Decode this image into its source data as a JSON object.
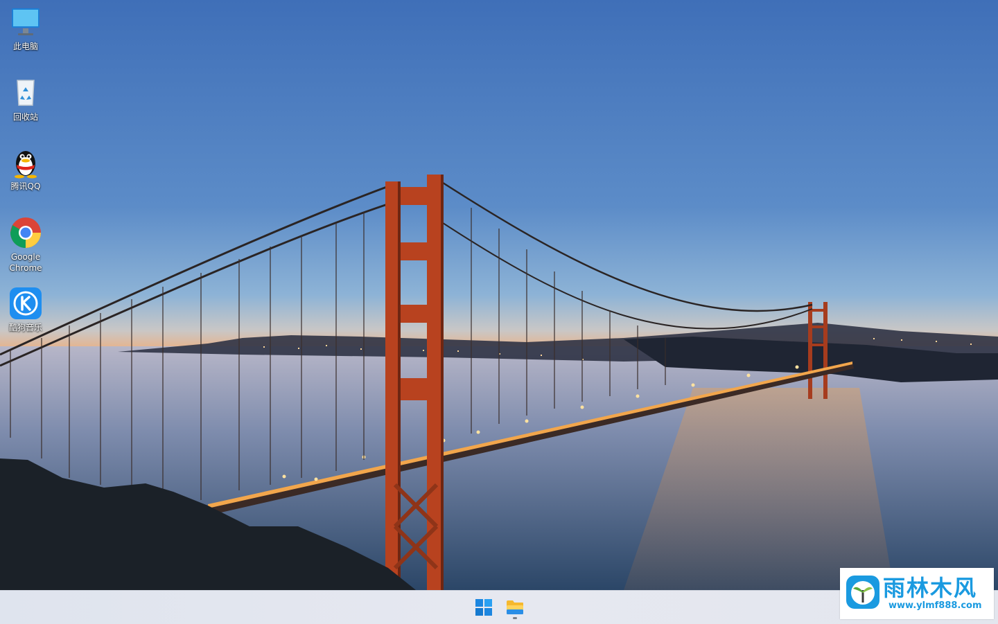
{
  "desktop": {
    "wallpaper": "Golden Gate bridge at dusk",
    "icons": [
      {
        "label": "此电脑",
        "icon": "this-pc-icon"
      },
      {
        "label": "回收站",
        "icon": "recycle-bin-icon"
      },
      {
        "label": "腾讯QQ",
        "icon": "qq-icon"
      },
      {
        "label": "Google Chrome",
        "icon": "chrome-icon"
      },
      {
        "label": "酷狗音乐",
        "icon": "kugou-music-icon"
      }
    ]
  },
  "taskbar": {
    "buttons": [
      {
        "name": "start",
        "icon": "windows-start-icon"
      },
      {
        "name": "file-explorer",
        "icon": "folder-icon",
        "running": true
      }
    ]
  },
  "watermark": {
    "name": "雨林木风",
    "url": "www.ylmf888.com",
    "accent": "#1a9ae0"
  },
  "colors": {
    "sky_top": "#3f6fb8",
    "sky_horizon": "#f3a868",
    "bridge": "#b8421f",
    "taskbar": "#e4e7ef"
  }
}
